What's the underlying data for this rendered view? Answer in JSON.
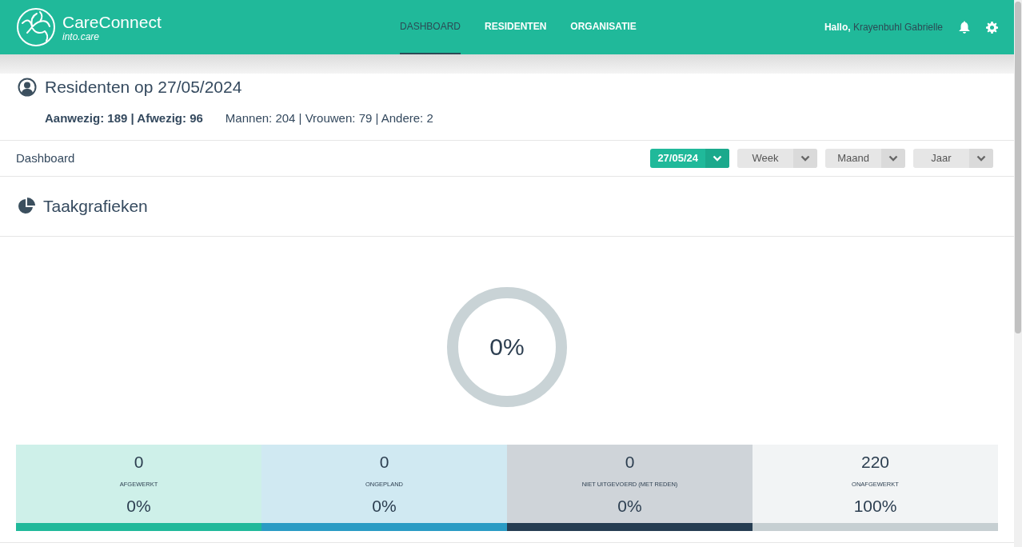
{
  "header": {
    "brand": "CareConnect",
    "tagline": "into.care",
    "nav": [
      {
        "label": "DASHBOARD",
        "selected": true
      },
      {
        "label": "RESIDENTEN",
        "selected": false
      },
      {
        "label": "ORGANISATIE",
        "selected": false
      }
    ],
    "greeting": "Hallo,",
    "user": "Krayenbuhl Gabrielle"
  },
  "residents": {
    "title": "Residenten op 27/05/2024",
    "presence": [
      "Aanwezig: 189",
      "|",
      "Afwezig: 96"
    ],
    "genders": [
      "Mannen: 204",
      "|",
      "Vrouwen: 79",
      "|",
      "Andere: 2"
    ]
  },
  "toolbar": {
    "title": "Dashboard",
    "filters": [
      {
        "label": "27/05/24",
        "selected": true
      },
      {
        "label": "Week",
        "selected": false
      },
      {
        "label": "Maand",
        "selected": false
      },
      {
        "label": "Jaar",
        "selected": false
      }
    ]
  },
  "tasks": {
    "title": "Taakgrafieken",
    "donut": {
      "label": "0%"
    },
    "stats": [
      {
        "count": "0",
        "label": "AFGEWERKT",
        "percent": "0%",
        "color": "#20b99a"
      },
      {
        "count": "0",
        "label": "ONGEPLAND",
        "percent": "0%",
        "color": "#2a9bc4"
      },
      {
        "count": "0",
        "label": "NIET UITGEVOERD (MET REDEN)",
        "percent": "0%",
        "color": "#263d52"
      },
      {
        "count": "220",
        "label": "ONAFGEWERKT",
        "percent": "100%",
        "color": "#c6cfd2"
      }
    ]
  }
}
